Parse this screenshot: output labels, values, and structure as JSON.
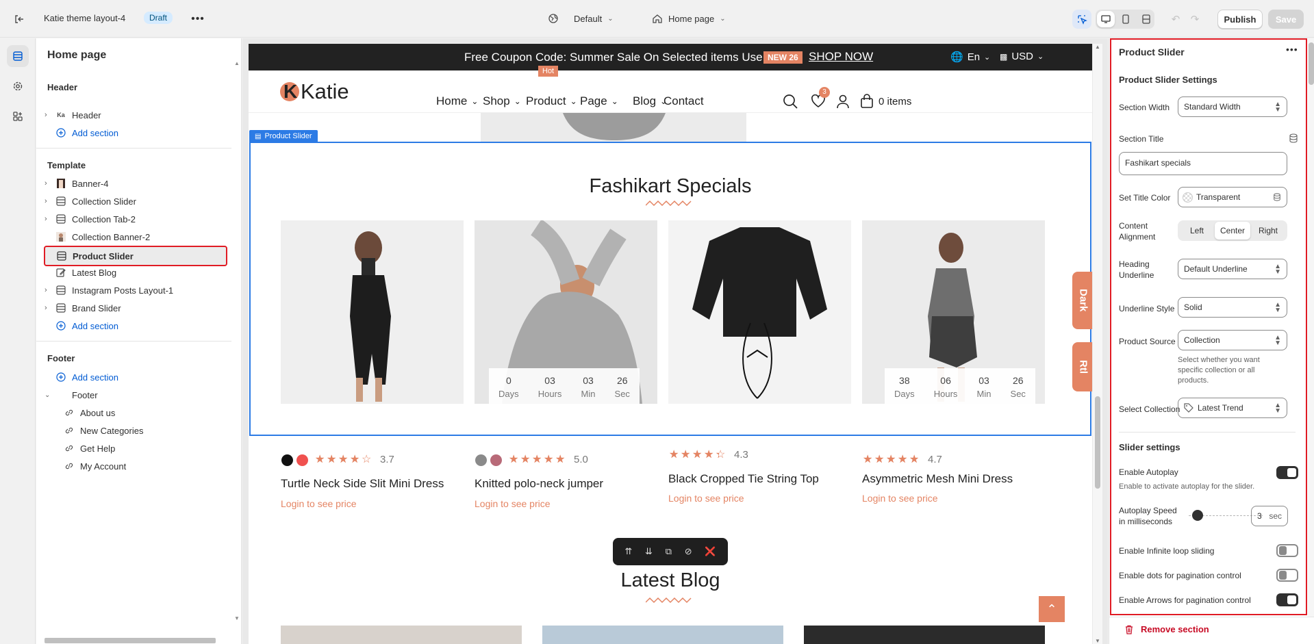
{
  "topbar": {
    "theme_name": "Katie theme layout-4",
    "status_badge": "Draft",
    "view_selector": "Default",
    "page_selector": "Home page",
    "publish_label": "Publish",
    "save_label": "Save"
  },
  "sidebar": {
    "title": "Home page",
    "header_group": "Header",
    "header_item": "Header",
    "header_add": "Add section",
    "template_group": "Template",
    "template_items": [
      "Banner-4",
      "Collection Slider",
      "Collection Tab-2",
      "Collection Banner-2",
      "Product Slider",
      "Latest Blog",
      "Instagram Posts Layout-1",
      "Brand Slider"
    ],
    "template_add": "Add section",
    "footer_group": "Footer",
    "footer_add": "Add section",
    "footer_item": "Footer",
    "footer_children": [
      "About us",
      "New Categories",
      "Get Help",
      "My Account"
    ]
  },
  "store": {
    "announcement_text": "Free Coupon Code: Summer Sale On Selected items Use:",
    "announcement_code": "NEW 26",
    "announcement_link": "SHOP NOW",
    "language": "En",
    "currency": "USD",
    "logo": "Katie",
    "logo_mark": "K",
    "nav": [
      "Home",
      "Shop",
      "Product",
      "Page",
      "Blog",
      "Contact"
    ],
    "hot_badge": "Hot",
    "wishlist_count": "3",
    "cart_label": "0 items",
    "section_tag": "Product Slider",
    "section_title": "Fashikart Specials",
    "side_tab_dark": "Dark",
    "side_tab_rtl": "Rtl",
    "timer_units": [
      "Days",
      "Hours",
      "Min",
      "Sec"
    ],
    "timer_1": [
      "0",
      "03",
      "03",
      "26"
    ],
    "timer_2": [
      "38",
      "06",
      "03",
      "26"
    ],
    "products": [
      {
        "title": "Turtle Neck Side Slit Mini Dress",
        "rating": "3.7",
        "stars": 3.7,
        "price": "Login to see price",
        "colors": [
          "#111111",
          "#f0514f"
        ]
      },
      {
        "title": "Knitted polo-neck jumper",
        "rating": "5.0",
        "stars": 5.0,
        "price": "Login to see price",
        "colors": [
          "#8a8a8a",
          "#b86a78"
        ]
      },
      {
        "title": "Black Cropped Tie String Top",
        "rating": "4.3",
        "stars": 4.3,
        "price": "Login to see price",
        "colors": []
      },
      {
        "title": "Asymmetric Mesh Mini Dress",
        "rating": "4.7",
        "stars": 4.7,
        "price": "Login to see price",
        "colors": []
      }
    ],
    "blog_title": "Latest Blog"
  },
  "settings": {
    "panel_title": "Product Slider",
    "group_title": "Product Slider Settings",
    "section_width_label": "Section Width",
    "section_width_value": "Standard Width",
    "section_title_label": "Section Title",
    "section_title_value": "Fashikart specials",
    "title_color_label": "Set Title Color",
    "title_color_value": "Transparent",
    "content_alignment_label": "Content Alignment",
    "alignment_options": [
      "Left",
      "Center",
      "Right"
    ],
    "alignment_selected": "Center",
    "heading_underline_label": "Heading Underline",
    "heading_underline_value": "Default Underline",
    "underline_style_label": "Underline Style",
    "underline_style_value": "Solid",
    "product_source_label": "Product Source",
    "product_source_value": "Collection",
    "product_source_help": "Select whether you want specific collection or all products.",
    "select_collection_label": "Select Collection",
    "select_collection_value": "Latest Trend",
    "slider_group": "Slider settings",
    "autoplay_label": "Enable Autoplay",
    "autoplay_on": true,
    "autoplay_help": "Enable to activate autoplay for the slider.",
    "autoplay_speed_label": "Autoplay Speed in milliseconds",
    "autoplay_speed_value": "3",
    "autoplay_speed_unit": "sec",
    "autoplay_speed_fraction": 0.12,
    "loop_label": "Enable Infinite loop sliding",
    "loop_on": false,
    "dots_label": "Enable dots for pagination control",
    "dots_on": false,
    "arrows_label": "Enable Arrows for pagination control",
    "arrows_on": true,
    "remove_label": "Remove section"
  },
  "colors": {
    "accent": "#e48463",
    "selection_red": "#e01b24",
    "selection_blue": "#2c7be5",
    "link_blue": "#005bd3"
  }
}
